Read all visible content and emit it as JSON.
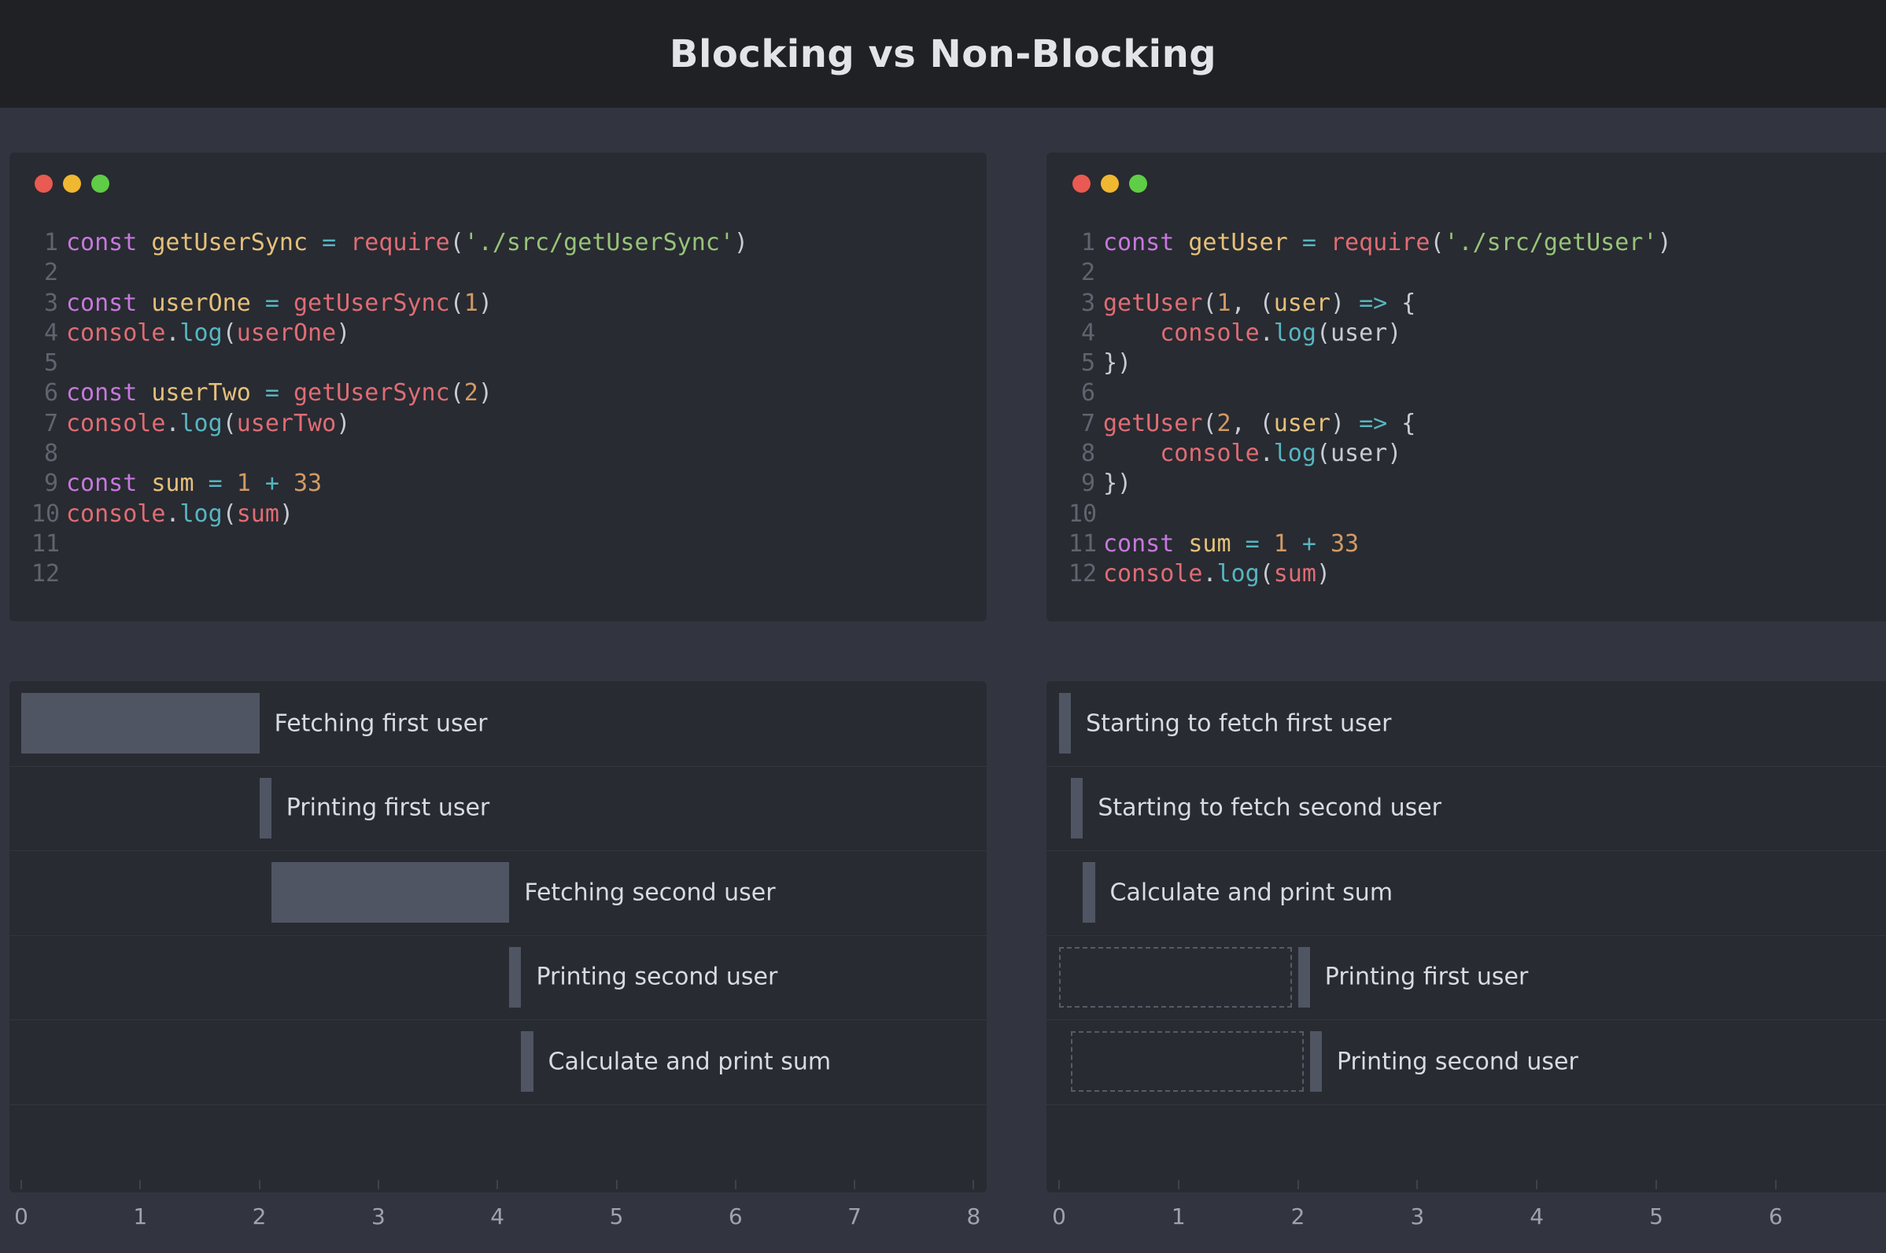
{
  "header": {
    "title": "Blocking vs Non-Blocking"
  },
  "left": {
    "code": [
      {
        "n": "1",
        "t": [
          [
            "kw",
            "const"
          ],
          [
            "p",
            " "
          ],
          [
            "id",
            "getUserSync"
          ],
          [
            "p",
            " "
          ],
          [
            "op",
            "="
          ],
          [
            "p",
            " "
          ],
          [
            "fn",
            "require"
          ],
          [
            "p",
            "("
          ],
          [
            "str",
            "'./src/getUserSync'"
          ],
          [
            "p",
            ")"
          ]
        ]
      },
      {
        "n": "2",
        "t": []
      },
      {
        "n": "3",
        "t": [
          [
            "kw",
            "const"
          ],
          [
            "p",
            " "
          ],
          [
            "id",
            "userOne"
          ],
          [
            "p",
            " "
          ],
          [
            "op",
            "="
          ],
          [
            "p",
            " "
          ],
          [
            "fn",
            "getUserSync"
          ],
          [
            "p",
            "("
          ],
          [
            "num",
            "1"
          ],
          [
            "p",
            ")"
          ]
        ]
      },
      {
        "n": "4",
        "t": [
          [
            "fn",
            "console"
          ],
          [
            "p",
            "."
          ],
          [
            "op",
            "log"
          ],
          [
            "p",
            "("
          ],
          [
            "fn",
            "userOne"
          ],
          [
            "p",
            ")"
          ]
        ]
      },
      {
        "n": "5",
        "t": []
      },
      {
        "n": "6",
        "t": [
          [
            "kw",
            "const"
          ],
          [
            "p",
            " "
          ],
          [
            "id",
            "userTwo"
          ],
          [
            "p",
            " "
          ],
          [
            "op",
            "="
          ],
          [
            "p",
            " "
          ],
          [
            "fn",
            "getUserSync"
          ],
          [
            "p",
            "("
          ],
          [
            "num",
            "2"
          ],
          [
            "p",
            ")"
          ]
        ]
      },
      {
        "n": "7",
        "t": [
          [
            "fn",
            "console"
          ],
          [
            "p",
            "."
          ],
          [
            "op",
            "log"
          ],
          [
            "p",
            "("
          ],
          [
            "fn",
            "userTwo"
          ],
          [
            "p",
            ")"
          ]
        ]
      },
      {
        "n": "8",
        "t": []
      },
      {
        "n": "9",
        "t": [
          [
            "kw",
            "const"
          ],
          [
            "p",
            " "
          ],
          [
            "id",
            "sum"
          ],
          [
            "p",
            " "
          ],
          [
            "op",
            "="
          ],
          [
            "p",
            " "
          ],
          [
            "num",
            "1"
          ],
          [
            "p",
            " "
          ],
          [
            "op",
            "+"
          ],
          [
            "p",
            " "
          ],
          [
            "num",
            "33"
          ]
        ]
      },
      {
        "n": "10",
        "t": [
          [
            "fn",
            "console"
          ],
          [
            "p",
            "."
          ],
          [
            "op",
            "log"
          ],
          [
            "p",
            "("
          ],
          [
            "fn",
            "sum"
          ],
          [
            "p",
            ")"
          ]
        ]
      },
      {
        "n": "11",
        "t": []
      },
      {
        "n": "12",
        "t": []
      }
    ],
    "timeline": {
      "axis_ticks": [
        "0",
        "1",
        "2",
        "3",
        "4",
        "5",
        "6",
        "7",
        "8"
      ],
      "events": [
        {
          "label": "Fetching first user",
          "start": 0,
          "end": 2,
          "kind": "block"
        },
        {
          "label": "Printing first user",
          "start": 2,
          "end": 2.1,
          "kind": "bar"
        },
        {
          "label": "Fetching second user",
          "start": 2.1,
          "end": 4.1,
          "kind": "block"
        },
        {
          "label": "Printing second user",
          "start": 4.1,
          "end": 4.2,
          "kind": "bar"
        },
        {
          "label": "Calculate and print sum",
          "start": 4.2,
          "end": 4.3,
          "kind": "bar"
        }
      ]
    }
  },
  "right": {
    "code": [
      {
        "n": "1",
        "t": [
          [
            "kw",
            "const"
          ],
          [
            "p",
            " "
          ],
          [
            "id",
            "getUser"
          ],
          [
            "p",
            " "
          ],
          [
            "op",
            "="
          ],
          [
            "p",
            " "
          ],
          [
            "fn",
            "require"
          ],
          [
            "p",
            "("
          ],
          [
            "str",
            "'./src/getUser'"
          ],
          [
            "p",
            ")"
          ]
        ]
      },
      {
        "n": "2",
        "t": []
      },
      {
        "n": "3",
        "t": [
          [
            "fn",
            "getUser"
          ],
          [
            "p",
            "("
          ],
          [
            "num",
            "1"
          ],
          [
            "p",
            ", ("
          ],
          [
            "id",
            "user"
          ],
          [
            "p",
            ") "
          ],
          [
            "op",
            "=>"
          ],
          [
            "p",
            " {"
          ]
        ]
      },
      {
        "n": "4",
        "t": [
          [
            "p",
            "    "
          ],
          [
            "fn",
            "console"
          ],
          [
            "p",
            "."
          ],
          [
            "op",
            "log"
          ],
          [
            "p",
            "(user)"
          ]
        ]
      },
      {
        "n": "5",
        "t": [
          [
            "p",
            "})"
          ]
        ]
      },
      {
        "n": "6",
        "t": []
      },
      {
        "n": "7",
        "t": [
          [
            "fn",
            "getUser"
          ],
          [
            "p",
            "("
          ],
          [
            "num",
            "2"
          ],
          [
            "p",
            ", ("
          ],
          [
            "id",
            "user"
          ],
          [
            "p",
            ") "
          ],
          [
            "op",
            "=>"
          ],
          [
            "p",
            " {"
          ]
        ]
      },
      {
        "n": "8",
        "t": [
          [
            "p",
            "    "
          ],
          [
            "fn",
            "console"
          ],
          [
            "p",
            "."
          ],
          [
            "op",
            "log"
          ],
          [
            "p",
            "(user)"
          ]
        ]
      },
      {
        "n": "9",
        "t": [
          [
            "p",
            "})"
          ]
        ]
      },
      {
        "n": "10",
        "t": []
      },
      {
        "n": "11",
        "t": [
          [
            "kw",
            "const"
          ],
          [
            "p",
            " "
          ],
          [
            "id",
            "sum"
          ],
          [
            "p",
            " "
          ],
          [
            "op",
            "="
          ],
          [
            "p",
            " "
          ],
          [
            "num",
            "1"
          ],
          [
            "p",
            " "
          ],
          [
            "op",
            "+"
          ],
          [
            "p",
            " "
          ],
          [
            "num",
            "33"
          ]
        ]
      },
      {
        "n": "12",
        "t": [
          [
            "fn",
            "console"
          ],
          [
            "p",
            "."
          ],
          [
            "op",
            "log"
          ],
          [
            "p",
            "("
          ],
          [
            "fn",
            "sum"
          ],
          [
            "p",
            ")"
          ]
        ]
      }
    ],
    "timeline": {
      "axis_ticks": [
        "0",
        "1",
        "2",
        "3",
        "4",
        "5",
        "6"
      ],
      "events": [
        {
          "label": "Starting to fetch first user",
          "start": 0,
          "end": 0.1,
          "kind": "bar"
        },
        {
          "label": "Starting to fetch second user",
          "start": 0.1,
          "end": 0.2,
          "kind": "bar"
        },
        {
          "label": "Calculate and print sum",
          "start": 0.2,
          "end": 0.3,
          "kind": "bar"
        },
        {
          "label": "Printing first user",
          "start": 2,
          "end": 2.1,
          "kind": "bar",
          "wait_start": 0
        },
        {
          "label": "Printing second user",
          "start": 2.1,
          "end": 2.2,
          "kind": "bar",
          "wait_start": 0.1
        }
      ]
    }
  },
  "colors": {
    "background": "#32353f",
    "header": "#1f2125",
    "panel": "#282b31",
    "bar": "#4f5563"
  }
}
